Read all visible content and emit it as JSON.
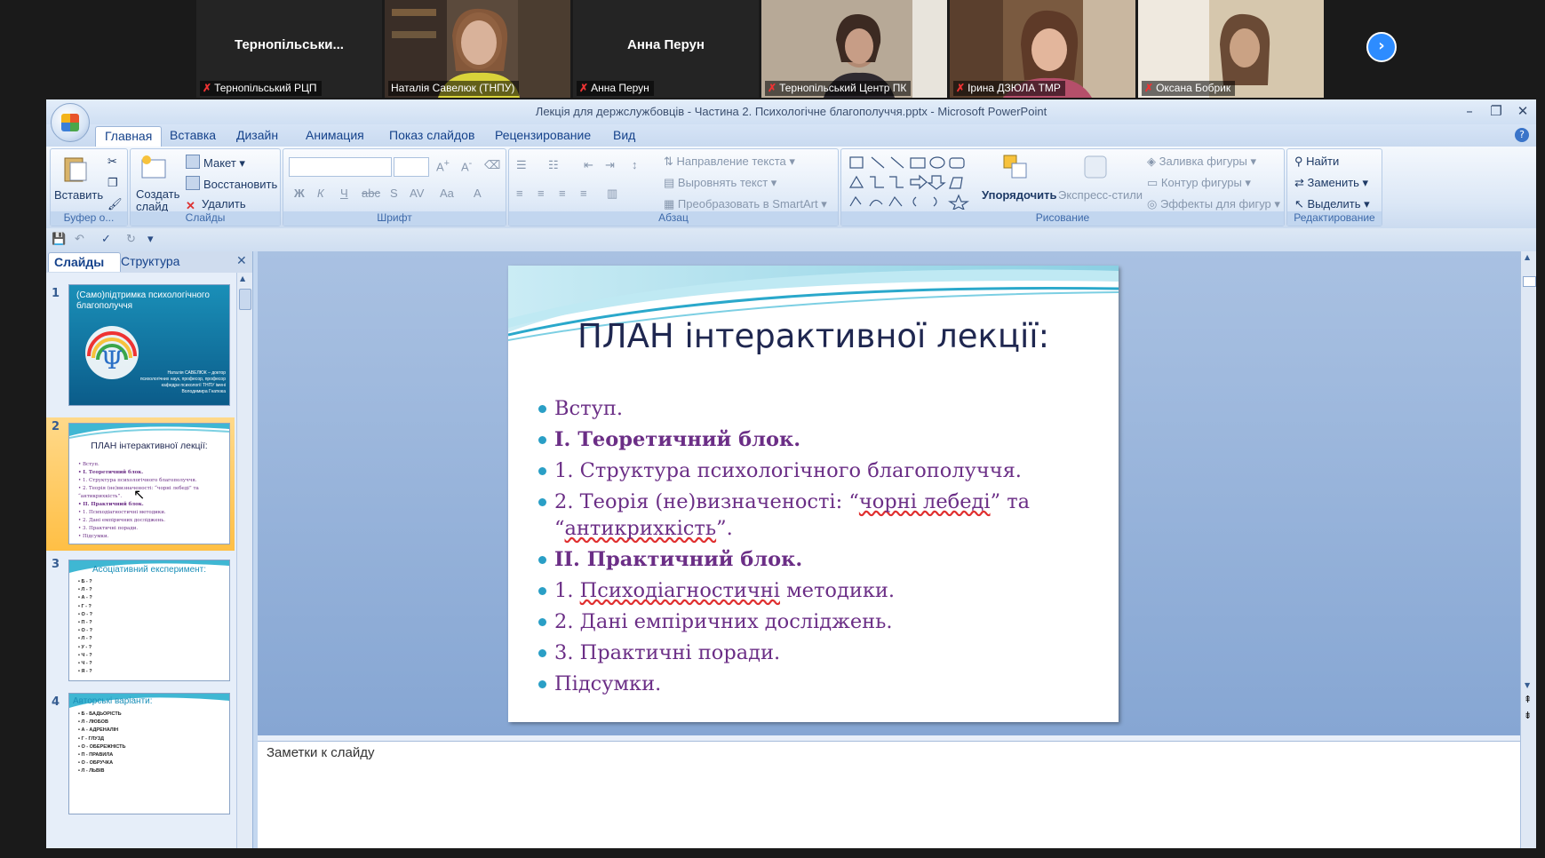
{
  "participants": [
    {
      "name": "Тернопільськи...",
      "label": "Тернопільський РЦП",
      "video": false
    },
    {
      "name": "",
      "label": "Наталія Савелюк (ТНПУ)",
      "video": true,
      "active": true
    },
    {
      "name": "Анна Перун",
      "label": "Анна Перун",
      "video": false
    },
    {
      "name": "",
      "label": "Тернопільський Центр ПК",
      "video": true
    },
    {
      "name": "",
      "label": "Ірина ДЗЮЛА ТМР",
      "video": true
    },
    {
      "name": "",
      "label": "Оксана Бобрик",
      "video": true
    }
  ],
  "window": {
    "title": "Лекція для держслужбовців - Частина 2. Психологічне благополуччя.pptx - Microsoft PowerPoint"
  },
  "ribbon_tabs": [
    "Главная",
    "Вставка",
    "Дизайн",
    "Анимация",
    "Показ слайдов",
    "Рецензирование",
    "Вид"
  ],
  "ribbon": {
    "clipboard": {
      "title": "Буфер о...",
      "paste": "Вставить"
    },
    "slides": {
      "title": "Слайды",
      "new_slide": "Создать слайд",
      "layout": "Макет",
      "reset": "Восстановить",
      "delete": "Удалить"
    },
    "font": {
      "title": "Шрифт"
    },
    "paragraph": {
      "title": "Абзац",
      "text_direction": "Направление текста",
      "align_text": "Выровнять текст",
      "smartart": "Преобразовать в SmartArt"
    },
    "drawing": {
      "title": "Рисование",
      "arrange": "Упорядочить",
      "quick_styles": "Экспресс-стили",
      "fill": "Заливка фигуры",
      "outline": "Контур фигуры",
      "effects": "Эффекты для фигур"
    },
    "editing": {
      "title": "Редактирование",
      "find": "Найти",
      "replace": "Заменить",
      "select": "Выделить"
    }
  },
  "pane": {
    "tab_slides": "Слайды",
    "tab_outline": "Структура",
    "thumbs": [
      {
        "num": "1",
        "title": "(Само)підтримка психологічного благополуччя",
        "author": "Наталія САВЕЛЮК – доктор психологічних наук, професор, професор кафедри психології ТНПУ імені Володимира Гнатюка"
      },
      {
        "num": "2",
        "title": "ПЛАН інтерактивної лекції:"
      },
      {
        "num": "3",
        "title": "Асоціативний експеримент:",
        "items": [
          "Б - ?",
          "Л - ?",
          "А - ?",
          "Г - ?",
          "О - ?",
          "П - ?",
          "О - ?",
          "Л - ?",
          "У - ?",
          "Ч - ?",
          "Ч - ?",
          "Я - ?"
        ]
      },
      {
        "num": "4",
        "title": "Авторські варіанти:",
        "items": [
          "Б - БАДЬОРІСТЬ",
          "Л - ЛЮБОВ",
          "А - АДРЕНАЛІН",
          "Г - ГЛУЗД",
          "О - ОБЕРЕЖНІСТЬ",
          "П - ПРАВИЛА",
          "О - ОБРУЧКА",
          "Л - ЛЬВІВ"
        ]
      }
    ]
  },
  "slide": {
    "title": "ПЛАН інтерактивної лекції:",
    "bullets": [
      {
        "text": "Вступ.",
        "bold": false
      },
      {
        "text": "I. Теоретичний блок.",
        "bold": true
      },
      {
        "text": "1. Структура психологічного благополуччя.",
        "bold": false
      },
      {
        "text": "2. Теорія (не)визначеності: “чорні лебеді” та “антикрихкість”.",
        "bold": false
      },
      {
        "text": "II. Практичний блок.",
        "bold": true
      },
      {
        "text": "1. Психодіагностичні методики.",
        "bold": false
      },
      {
        "text": "2. Дані емпіричних досліджень.",
        "bold": false
      },
      {
        "text": "3. Практичні поради.",
        "bold": false
      },
      {
        "text": "Підсумки.",
        "bold": false
      }
    ]
  },
  "notes": {
    "label": "Заметки к слайду"
  }
}
